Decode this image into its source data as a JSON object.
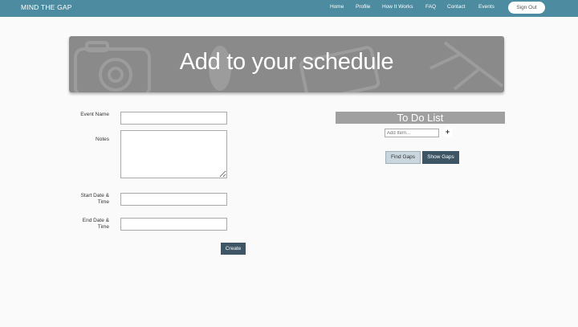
{
  "navbar": {
    "brand": "MIND THE GAP",
    "links": [
      "Home",
      "Profile",
      "How It Works",
      "FAQ",
      "Contact",
      "Events"
    ],
    "signout_label": "Sign Out"
  },
  "hero": {
    "title": "Add to your schedule"
  },
  "form": {
    "event_name_label": "Event Name",
    "notes_label": "Notes",
    "start_label_line1": "Start Date &",
    "start_label_line2": "Time",
    "end_label_line1": "End Date &",
    "end_label_line2": "Time",
    "create_label": "Create"
  },
  "todo": {
    "header": "To Do List",
    "add_placeholder": "Add Item...",
    "plus_label": "+",
    "find_label": "Find Gaps",
    "show_label": "Show Gaps"
  },
  "colors": {
    "navbar": "#4c8ba0",
    "button_dark": "#3e5566",
    "hero": "#8a8a8a"
  }
}
